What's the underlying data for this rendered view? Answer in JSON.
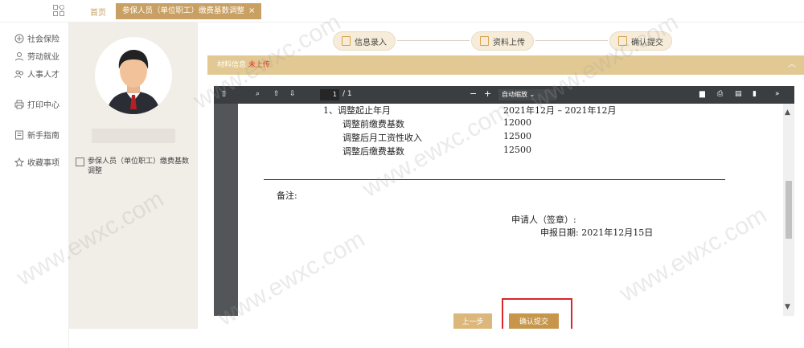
{
  "topbar": {
    "home_tab": "首页",
    "active_tab": "参保人员（单位职工）缴费基数调整",
    "close_glyph": "×"
  },
  "leftnav": {
    "items": [
      {
        "label": "社会保险",
        "icon": "shield-icon"
      },
      {
        "label": "劳动就业",
        "icon": "worker-icon"
      },
      {
        "label": "人事人才",
        "icon": "people-icon"
      },
      {
        "label": "打印中心",
        "icon": "printer-icon"
      },
      {
        "label": "新手指南",
        "icon": "guide-icon"
      },
      {
        "label": "收藏事项",
        "icon": "star-icon"
      }
    ]
  },
  "sidebar": {
    "item_label": "参保人员（单位职工）缴费基数调整"
  },
  "steps": [
    {
      "label": "信息录入"
    },
    {
      "label": "资料上传"
    },
    {
      "label": "确认提交"
    }
  ],
  "materials": {
    "label": "材料信息",
    "status": "未上传"
  },
  "pdf": {
    "page_current": "1",
    "page_total": "/ 1",
    "zoom": "自动缩放",
    "lines": {
      "row1_label": "1、调整起止年月",
      "row1_value": "2021年12月   –   2021年12月",
      "row2_label": "调整前缴费基数",
      "row2_value": "12000",
      "row3_label": "调整后月工资性收入",
      "row3_value": "12500",
      "row4_label": "调整后缴费基数",
      "row4_value": "12500",
      "remark": "备注:",
      "applicant": "申请人（签章）:",
      "date": "申报日期:   2021年12月15日"
    }
  },
  "buttons": {
    "prev": "上一步",
    "submit": "确认提交"
  },
  "colors": {
    "accent": "#c9a063",
    "status_red": "#e0341a",
    "highlight": "#d9262b"
  },
  "watermark": "www.ewxc.com"
}
